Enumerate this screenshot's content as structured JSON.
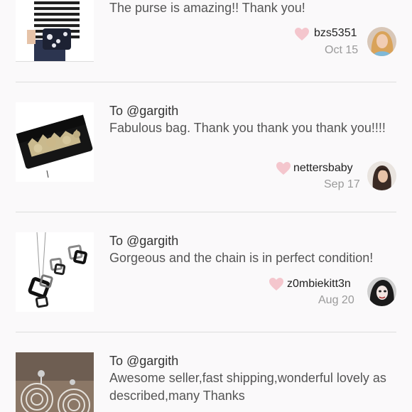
{
  "colors": {
    "heart": "#f4c6cd",
    "divider": "#dddddd",
    "background": "#faf9fa"
  },
  "feedback": [
    {
      "to": "",
      "message": "The purse is amazing!! Thank you!",
      "username": "bzs5351",
      "date": "Oct 15",
      "liked": true,
      "thumbnail": "striped-shirt-model-with-purse",
      "avatar": "user-avatar"
    },
    {
      "to": "To @gargith",
      "message": "Fabulous bag. Thank you thank you thank you!!!!",
      "username": "nettersbaby",
      "date": "Sep 17",
      "liked": true,
      "thumbnail": "black-gold-clutch",
      "avatar": "user-avatar"
    },
    {
      "to": "To @gargith",
      "message": "Gorgeous and the chain is in perfect condition!",
      "username": "z0mbiekitt3n",
      "date": "Aug 20",
      "liked": true,
      "thumbnail": "square-pendant-jewelry-set",
      "avatar": "user-avatar"
    },
    {
      "to": "To @gargith",
      "message": "Awesome seller,fast shipping,wonderful lovely as described,many Thanks",
      "username": "",
      "date": "",
      "liked": false,
      "thumbnail": "ring-hoop-earrings",
      "avatar": ""
    }
  ]
}
